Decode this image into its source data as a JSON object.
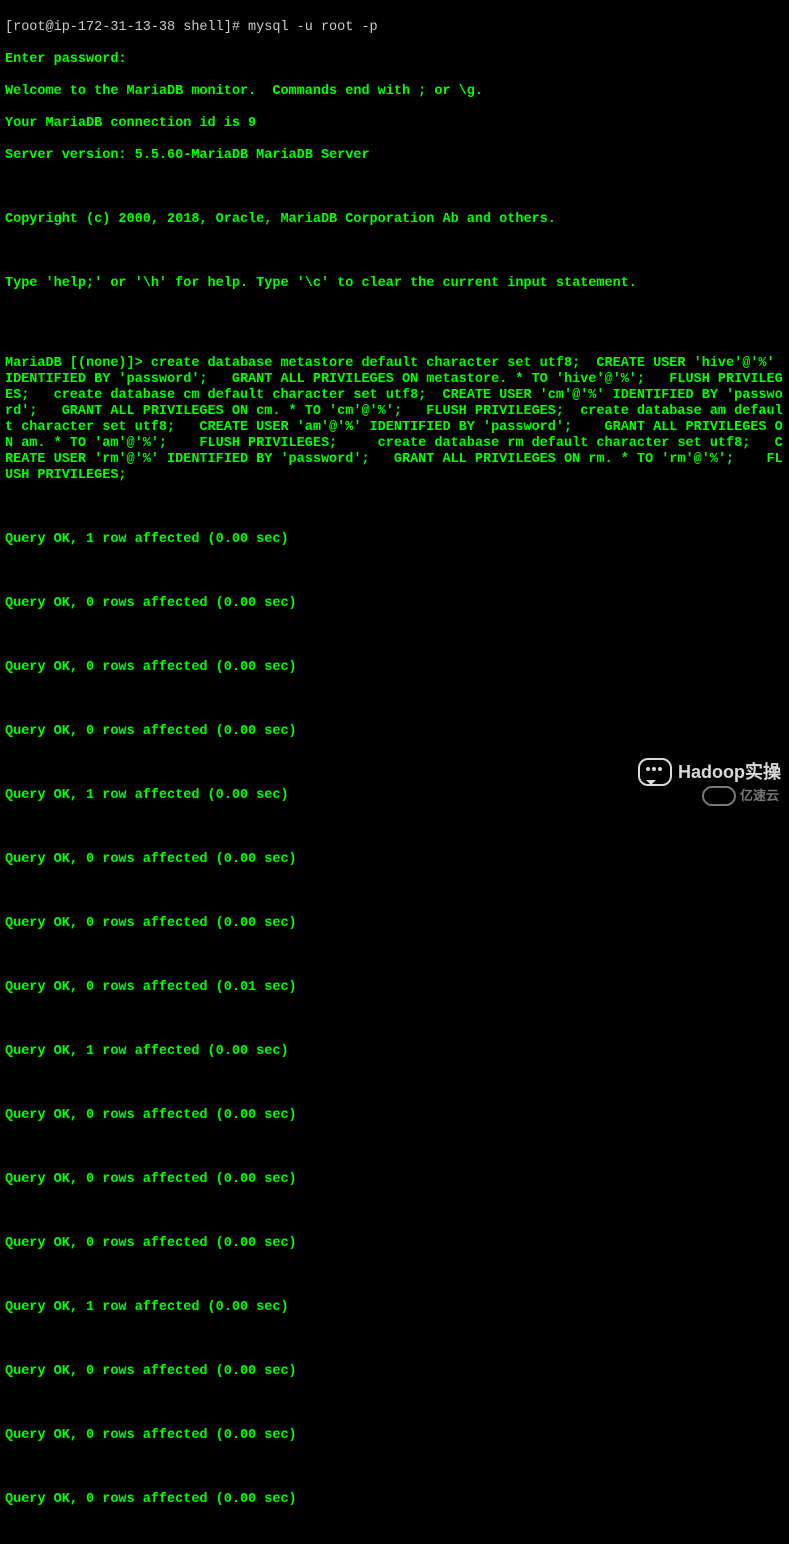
{
  "prompt_line": "[root@ip-172-31-13-38 shell]# mysql -u root -p",
  "lines": [
    "Enter password:",
    "Welcome to the MariaDB monitor.  Commands end with ; or \\g.",
    "Your MariaDB connection id is 9",
    "Server version: 5.5.60-MariaDB MariaDB Server",
    "",
    "Copyright (c) 2000, 2018, Oracle, MariaDB Corporation Ab and others.",
    "",
    "Type 'help;' or '\\h' for help. Type '\\c' to clear the current input statement.",
    ""
  ],
  "sql_block": "MariaDB [(none)]> create database metastore default character set utf8;  CREATE USER 'hive'@'%' IDENTIFIED BY 'password';   GRANT ALL PRIVILEGES ON metastore. * TO 'hive'@'%';   FLUSH PRIVILEGES;   create database cm default character set utf8;  CREATE USER 'cm'@'%' IDENTIFIED BY 'password';   GRANT ALL PRIVILEGES ON cm. * TO 'cm'@'%';   FLUSH PRIVILEGES;  create database am default character set utf8;   CREATE USER 'am'@'%' IDENTIFIED BY 'password';    GRANT ALL PRIVILEGES ON am. * TO 'am'@'%';    FLUSH PRIVILEGES;     create database rm default character set utf8;   CREATE USER 'rm'@'%' IDENTIFIED BY 'password';   GRANT ALL PRIVILEGES ON rm. * TO 'rm'@'%';    FLUSH PRIVILEGES;",
  "results": [
    "Query OK, 1 row affected (0.00 sec)",
    "",
    "Query OK, 0 rows affected (0.00 sec)",
    "",
    "Query OK, 0 rows affected (0.00 sec)",
    "",
    "Query OK, 0 rows affected (0.00 sec)",
    "",
    "Query OK, 1 row affected (0.00 sec)",
    "",
    "Query OK, 0 rows affected (0.00 sec)",
    "",
    "Query OK, 0 rows affected (0.00 sec)",
    "",
    "Query OK, 0 rows affected (0.01 sec)",
    "",
    "Query OK, 1 row affected (0.00 sec)",
    "",
    "Query OK, 0 rows affected (0.00 sec)",
    "",
    "Query OK, 0 rows affected (0.00 sec)",
    "",
    "Query OK, 0 rows affected (0.00 sec)",
    "",
    "Query OK, 1 row affected (0.00 sec)",
    "",
    "Query OK, 0 rows affected (0.00 sec)",
    "",
    "Query OK, 0 rows affected (0.00 sec)",
    "",
    "Query OK, 0 rows affected (0.00 sec)"
  ],
  "watermark": {
    "wechat_label": "Hadoop实操",
    "cloud_label": "亿速云"
  }
}
